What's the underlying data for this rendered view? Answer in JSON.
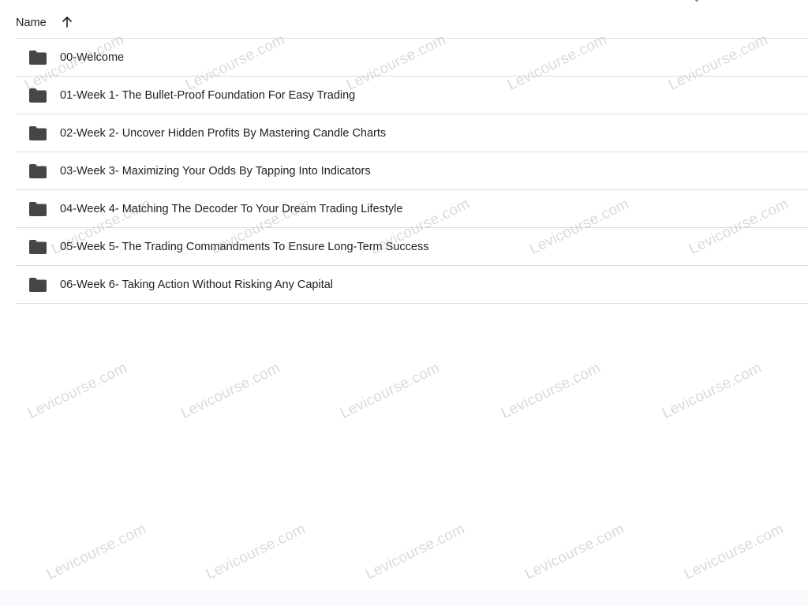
{
  "header": {
    "name_label": "Name",
    "sort_icon": "arrow-upward-icon",
    "corner_glyph": "↯"
  },
  "rows": [
    {
      "label": "00-Welcome",
      "icon": "folder-icon"
    },
    {
      "label": "01-Week 1- The Bullet-Proof Foundation For Easy Trading",
      "icon": "folder-icon"
    },
    {
      "label": "02-Week 2- Uncover Hidden Profits By Mastering Candle Charts",
      "icon": "folder-icon"
    },
    {
      "label": "03-Week 3- Maximizing Your Odds By Tapping Into Indicators",
      "icon": "folder-icon"
    },
    {
      "label": "04-Week 4- Matching The Decoder To Your Dream Trading Lifestyle",
      "icon": "folder-icon"
    },
    {
      "label": "05-Week 5- The Trading Commandments To Ensure Long-Term Success",
      "icon": "folder-icon"
    },
    {
      "label": "06-Week 6- Taking Action Without Risking Any Capital",
      "icon": "folder-icon"
    }
  ],
  "watermark": {
    "text": "Levicourse.com"
  },
  "colors": {
    "folder": "#444746",
    "divider": "#dadce0",
    "text": "#1f1f1f"
  }
}
